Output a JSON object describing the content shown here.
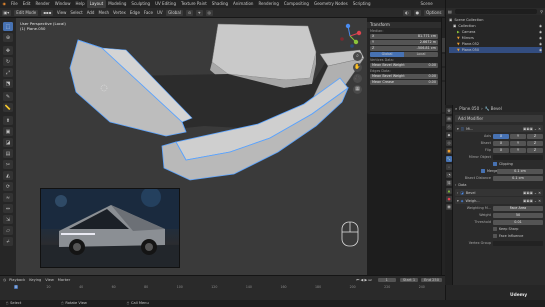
{
  "menubar": {
    "items": [
      "File",
      "Edit",
      "Render",
      "Window",
      "Help"
    ],
    "workspaces": [
      "Layout",
      "Modeling",
      "Sculpting",
      "UV Editing",
      "Texture Paint",
      "Shading",
      "Animation",
      "Rendering",
      "Compositing",
      "Geometry Nodes",
      "Scripting"
    ],
    "scene_label": "Scene",
    "view_layer_label": "ViewLayer"
  },
  "viewport_header": {
    "mode": "Edit Mode",
    "menus": [
      "View",
      "Select",
      "Add",
      "Mesh",
      "Vertex",
      "Edge",
      "Face",
      "UV"
    ],
    "transform_orientation": "Global",
    "options": "Options"
  },
  "viewport": {
    "view_name": "User Perspective (Local)",
    "object_name": "(1) Plane.050"
  },
  "npanel": {
    "title": "Transform",
    "median_label": "Median:",
    "x_label": "X",
    "x_value": "81.771 cm",
    "y_label": "Y",
    "y_value": "2.6672 m",
    "z_label": "Z",
    "z_value": "-506.81 cm",
    "global": "Global",
    "local": "Local",
    "vertices_data": "Vertices Data:",
    "mean_bevel_weight": "Mean Bevel Weight",
    "vw_value": "0.00",
    "edges_data": "Edges Data:",
    "mean_bevel_weight2": "Mean Bevel Weight",
    "ew_value": "0.00",
    "mean_crease": "Mean Crease",
    "crease_value": "0.00",
    "tabs": [
      "Item",
      "Tool",
      "View",
      "Screencast Keys",
      "Edit"
    ]
  },
  "outliner": {
    "header": "Scene Collection",
    "items": [
      {
        "name": "Scene Collection",
        "depth": 0
      },
      {
        "name": "Collection",
        "depth": 1
      },
      {
        "name": "Camera",
        "depth": 2
      },
      {
        "name": "Mirrors",
        "depth": 2
      },
      {
        "name": "Plane.052",
        "depth": 2
      },
      {
        "name": "Plane.050",
        "depth": 2
      }
    ]
  },
  "properties": {
    "object_name": "Plane.050",
    "modifier_name": "Bevel",
    "add_modifier": "Add Modifier",
    "mirror_modifier": "Mi...",
    "axis_label": "Axis",
    "bisect_label": "Bisect",
    "flip_label": "Flip",
    "axes": [
      "X",
      "Y",
      "Z"
    ],
    "mirror_object_label": "Mirror Object",
    "clipping_label": "Clipping",
    "merge_label": "Merge",
    "merge_value": "0.1 cm",
    "bisect_distance_label": "Bisect Distance",
    "bisect_distance_value": "0.1 cm",
    "data_label": "Data",
    "bevel_modifier": "Bevel",
    "weld_modifier": "Weigh...",
    "weighting_mode_label": "Weighting M...",
    "weighting_mode_value": "Face Area",
    "weight_label": "Weight",
    "weight_value": "50",
    "threshold_label": "Threshold",
    "threshold_value": "0.01",
    "keep_sharp_label": "Keep Sharp",
    "face_influence_label": "Face Influence",
    "vertex_group_label": "Vertex Group"
  },
  "timeline": {
    "playback": "Playback",
    "keying": "Keying",
    "view": "View",
    "marker": "Marker",
    "current_frame": "1",
    "start_label": "Start",
    "start_value": "1",
    "end_label": "End",
    "end_value": "250",
    "ticks": [
      "0",
      "20",
      "40",
      "60",
      "80",
      "100",
      "120",
      "140",
      "160",
      "180",
      "200",
      "220",
      "240"
    ]
  },
  "statusbar": {
    "select": "Select",
    "rotate_view": "Rotate View",
    "call_menu": "Call Menu",
    "watermark": "Udemy"
  },
  "colors": {
    "accent": "#4772b3",
    "selection": "#5aa3ff",
    "background": "#1d1d1d"
  }
}
